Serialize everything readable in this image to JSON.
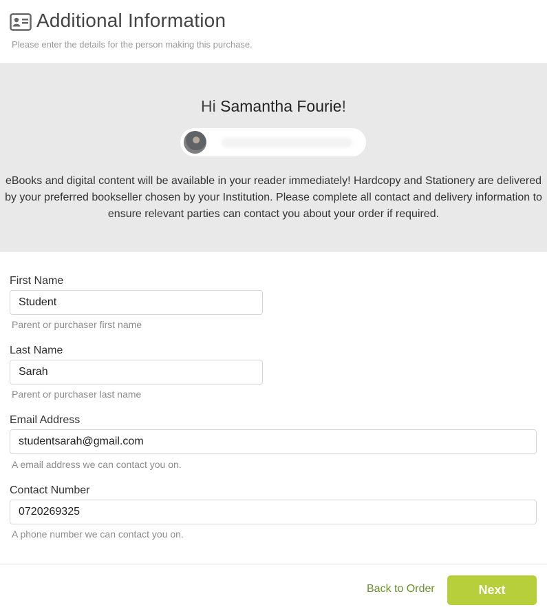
{
  "header": {
    "title": "Additional Information",
    "subtitle": "Please enter the details for the person making this purchase.",
    "icon": "id-card-icon"
  },
  "banner": {
    "greeting_prefix": "Hi ",
    "user_name": "Samantha Fourie",
    "greeting_suffix": "!",
    "info_text": "eBooks and digital content will be available in your reader immediately! Hardcopy and Stationery are delivered by your preferred bookseller chosen by your Institution. Please complete all contact and delivery information to ensure relevant parties can contact you about your order if required."
  },
  "form": {
    "first_name": {
      "label": "First Name",
      "value": "Student",
      "help": "Parent or purchaser first name"
    },
    "last_name": {
      "label": "Last Name",
      "value": "Sarah",
      "help": "Parent or purchaser last name"
    },
    "email": {
      "label": "Email Address",
      "value": "studentsarah@gmail.com",
      "help": "A email address we can contact you on."
    },
    "contact": {
      "label": "Contact Number",
      "value": "0720269325",
      "help": "A phone number we can contact you on."
    }
  },
  "footer": {
    "back_label": "Back to Order",
    "next_label": "Next"
  },
  "colors": {
    "accent": "#b6cf3a",
    "link": "#6a8f2d",
    "banner_bg": "#e9e9e9"
  }
}
